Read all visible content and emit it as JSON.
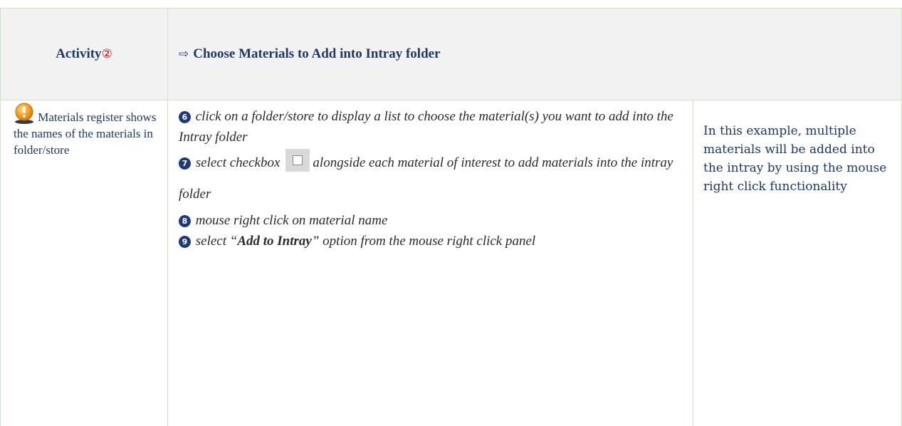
{
  "header": {
    "activity_label": "Activity",
    "activity_number": "②",
    "arrow": "⇨",
    "title": "Choose Materials to Add into Intray folder"
  },
  "note": {
    "icon": "warning-icon",
    "text": "Materials register shows the names of the materials in folder/store"
  },
  "steps": [
    {
      "num": "6",
      "text": "click on a folder/store to display a list to choose the material(s) you want to add into the Intray folder"
    },
    {
      "num": "7",
      "text_before": "select checkbox",
      "icon": "checkbox-icon",
      "text_after": "alongside each material of interest to add materials into the intray folder"
    },
    {
      "num": "8",
      "text": "mouse right click on material name"
    },
    {
      "num": "9",
      "text_before": "select “",
      "bold": "Add to Intray",
      "text_after": "” option from the mouse right click panel"
    }
  ],
  "example": {
    "text": "In this example, multiple materials will be added into the intray by using the mouse right click functionality"
  },
  "colors": {
    "border": "#cfe5bf",
    "header_bg": "#f2f2f2",
    "text_navy": "#1f3864",
    "accent_red": "#e00000",
    "step_badge": "#1e3a78"
  }
}
